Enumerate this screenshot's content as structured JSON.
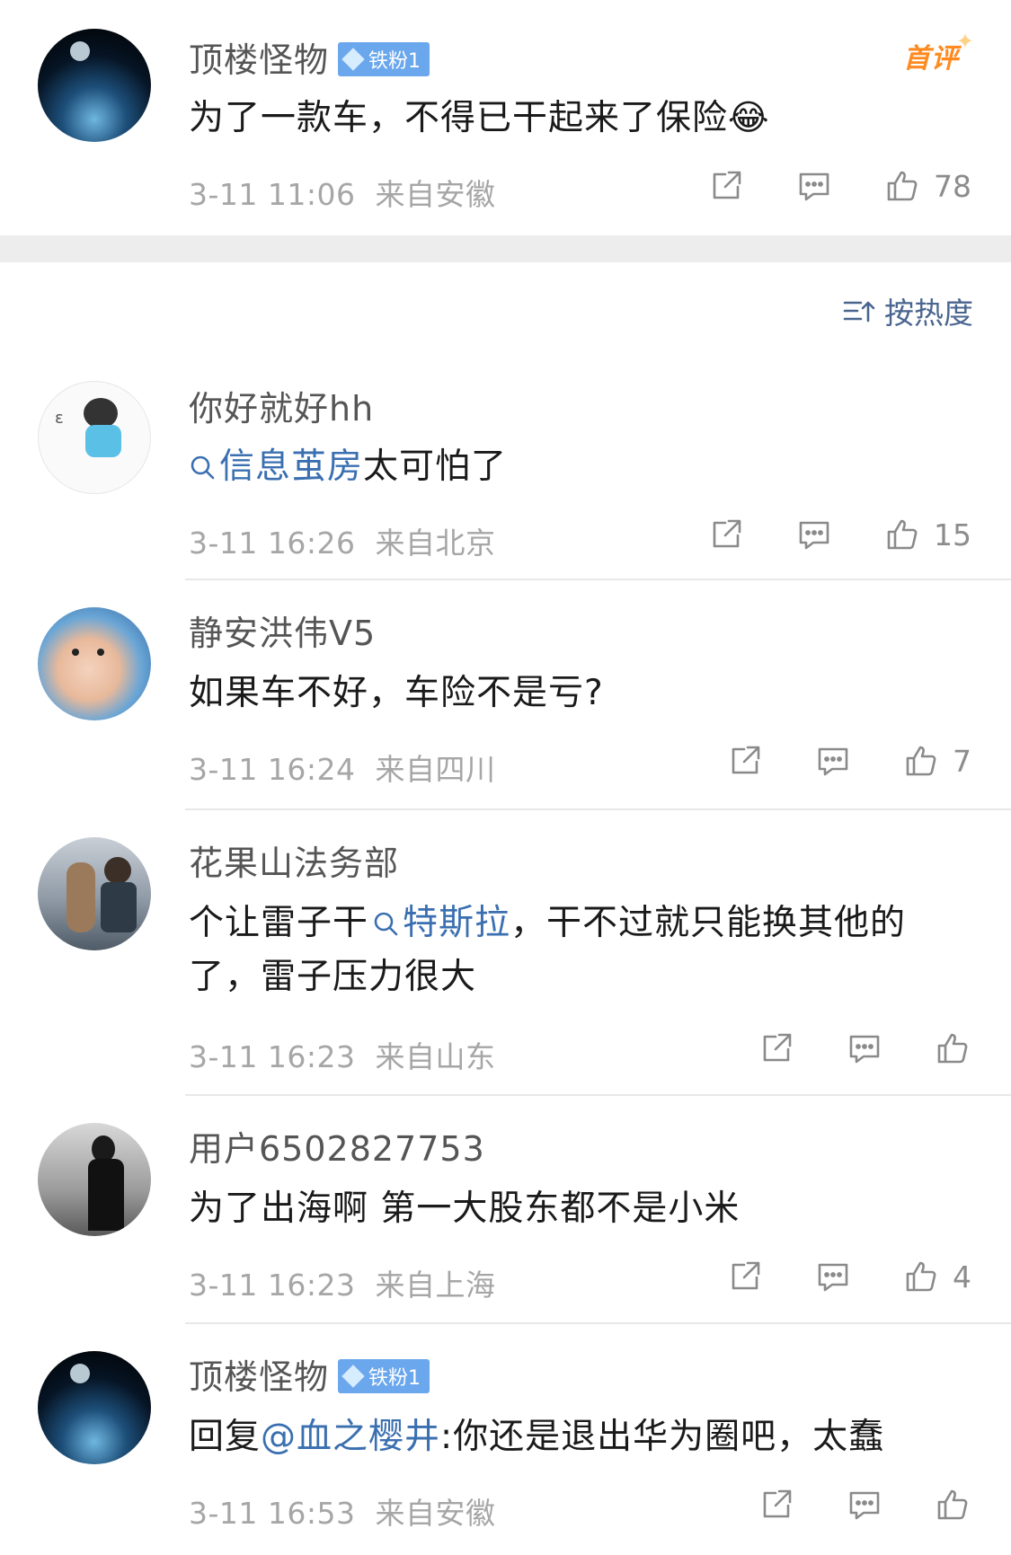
{
  "post": {
    "user": "顶楼怪物",
    "badge": "铁粉1",
    "text": "为了一款车，不得已干起来了保险",
    "emoji": "😂",
    "time": "3-11 11:06",
    "location": "来自安徽",
    "first_comment_label": "首评",
    "likes": "78"
  },
  "sort_label": "按热度",
  "comments": [
    {
      "user": "你好就好hh",
      "text_link": "信息茧房",
      "text_rest": "太可怕了",
      "time": "3-11 16:26",
      "location": "来自北京",
      "likes": "15"
    },
    {
      "user": "静安洪伟V5",
      "text": "如果车不好，车险不是亏?",
      "time": "3-11 16:24",
      "location": "来自四川",
      "likes": "7"
    },
    {
      "user": "花果山法务部",
      "text_pre": "个让雷子干",
      "text_link": "特斯拉",
      "text_post": "，干不过就只能换其他的了，雷子压力很大",
      "time": "3-11 16:23",
      "location": "来自山东",
      "likes": ""
    },
    {
      "user": "用户6502827753",
      "text": "为了出海啊 第一大股东都不是小米",
      "time": "3-11 16:23",
      "location": "来自上海",
      "likes": "4"
    },
    {
      "user": "顶楼怪物",
      "badge": "铁粉1",
      "text_pre": "回复",
      "text_link": "@血之樱井",
      "text_post": ":你还是退出华为圈吧，太蠢",
      "time": "3-11 16:53",
      "location": "来自安徽",
      "likes": ""
    }
  ],
  "colors": {
    "link": "#3a6fb0",
    "meta": "#a6a6a6",
    "badge": "#6ba7ec",
    "first_comment": "#ff8a1f"
  }
}
